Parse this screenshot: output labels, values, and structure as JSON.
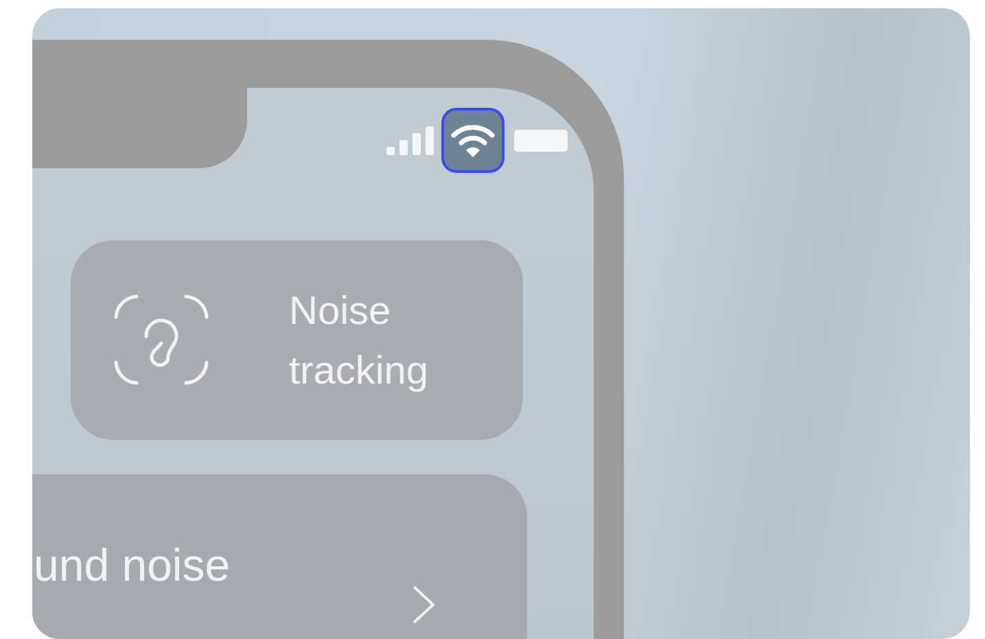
{
  "status_bar": {
    "wifi_highlighted": true
  },
  "cards": [
    {
      "kind": "feature",
      "label": "Noise tracking"
    },
    {
      "kind": "link",
      "label": "und noise"
    }
  ]
}
